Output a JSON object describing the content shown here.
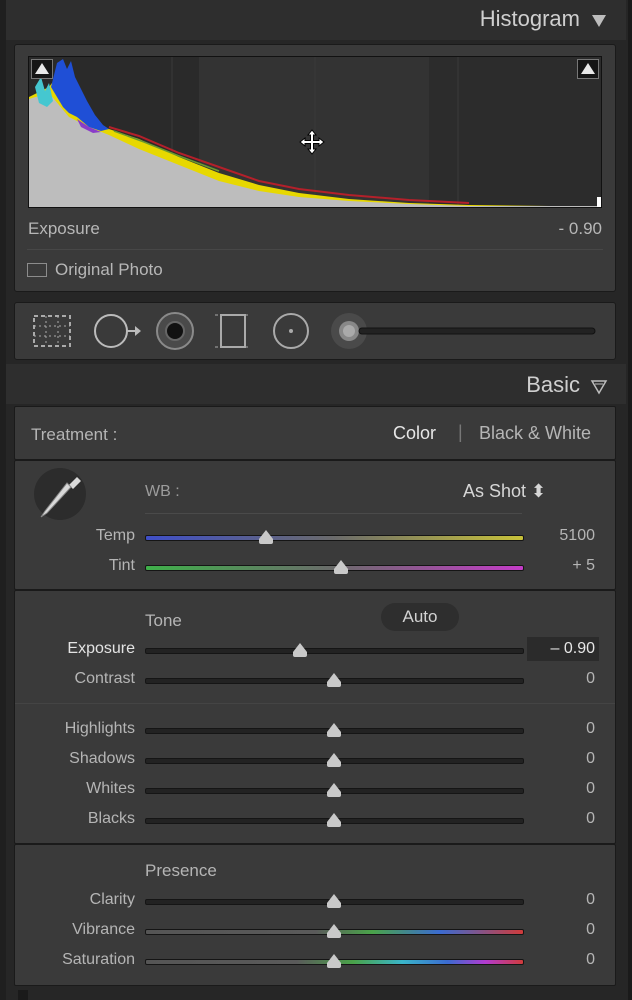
{
  "histogram_panel": {
    "title": "Histogram",
    "readout_label": "Exposure",
    "readout_value": "- 0.90",
    "original_photo_label": "Original Photo"
  },
  "basic_panel": {
    "title": "Basic",
    "treatment_label": "Treatment :",
    "treatment_options": [
      "Color",
      "Black & White"
    ],
    "treatment_selected": "Color",
    "wb_label": "WB :",
    "wb_value": "As Shot ⬍",
    "tone_label": "Tone",
    "auto_label": "Auto",
    "presence_label": "Presence",
    "sliders": {
      "temp": {
        "label": "Temp",
        "value": "5100",
        "position": 0.32
      },
      "tint": {
        "label": "Tint",
        "value": "+ 5",
        "position": 0.52
      },
      "exposure": {
        "label": "Exposure",
        "value": "– 0.90",
        "position": 0.41
      },
      "contrast": {
        "label": "Contrast",
        "value": "0",
        "position": 0.5
      },
      "highlights": {
        "label": "Highlights",
        "value": "0",
        "position": 0.5
      },
      "shadows": {
        "label": "Shadows",
        "value": "0",
        "position": 0.5
      },
      "whites": {
        "label": "Whites",
        "value": "0",
        "position": 0.5
      },
      "blacks": {
        "label": "Blacks",
        "value": "0",
        "position": 0.5
      },
      "clarity": {
        "label": "Clarity",
        "value": "0",
        "position": 0.5
      },
      "vibrance": {
        "label": "Vibrance",
        "value": "0",
        "position": 0.5
      },
      "saturation": {
        "label": "Saturation",
        "value": "0",
        "position": 0.5
      }
    }
  },
  "tools": [
    "crop-overlay-icon",
    "spot-removal-icon",
    "red-eye-icon",
    "graduated-filter-icon",
    "radial-filter-icon",
    "adjustment-brush-icon"
  ],
  "colors": {
    "panel_bg": "#3a3a3a",
    "histogram_yellow": "#e7d800",
    "histogram_blue": "#1f4fd6",
    "histogram_cyan": "#45c7d0",
    "histogram_gray": "#bdbdbd"
  }
}
